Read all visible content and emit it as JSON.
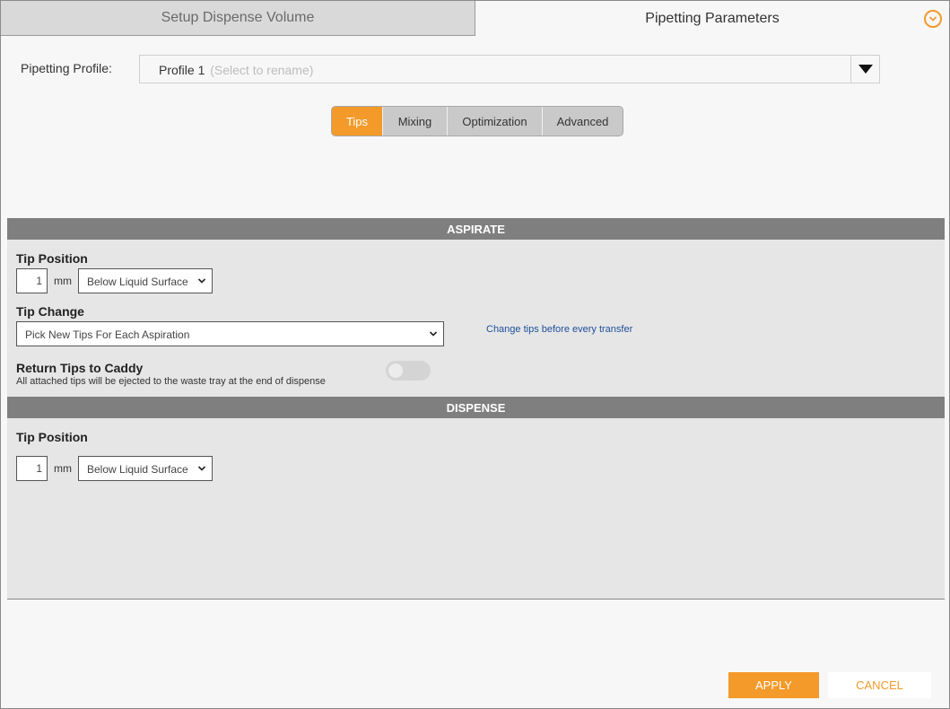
{
  "tabs": {
    "setup_label": "Setup Dispense Volume",
    "pipetting_label": "Pipetting Parameters"
  },
  "profile": {
    "label": "Pipetting Profile:",
    "name": "Profile 1",
    "hint": "(Select to rename)"
  },
  "subtabs": [
    "Tips",
    "Mixing",
    "Optimization",
    "Advanced"
  ],
  "active_subtab": "Tips",
  "aspirate": {
    "header": "ASPIRATE",
    "tip_position_label": "Tip Position",
    "tip_position_value": "1",
    "tip_position_unit": "mm",
    "tip_position_reference": "Below Liquid Surface",
    "tip_change_label": "Tip Change",
    "tip_change_value": "Pick New Tips For Each Aspiration",
    "tip_change_hint": "Change tips before every transfer",
    "return_tips_label": "Return Tips to Caddy",
    "return_tips_note": "All attached tips will be ejected to the waste tray at the end of dispense",
    "return_tips_enabled": false
  },
  "dispense": {
    "header": "DISPENSE",
    "tip_position_label": "Tip Position",
    "tip_position_value": "1",
    "tip_position_unit": "mm",
    "tip_position_reference": "Below Liquid Surface"
  },
  "footer": {
    "apply_label": "APPLY",
    "cancel_label": "CANCEL"
  },
  "colors": {
    "accent": "#f39a2a",
    "section_header": "#7f7f7f",
    "panel": "#e6e6e6",
    "link": "#1d4f9c"
  },
  "icons": {
    "collapse": "chevron-down-circle-icon",
    "profile_dropdown": "caret-down-icon",
    "select_caret": "chevron-down-icon"
  }
}
